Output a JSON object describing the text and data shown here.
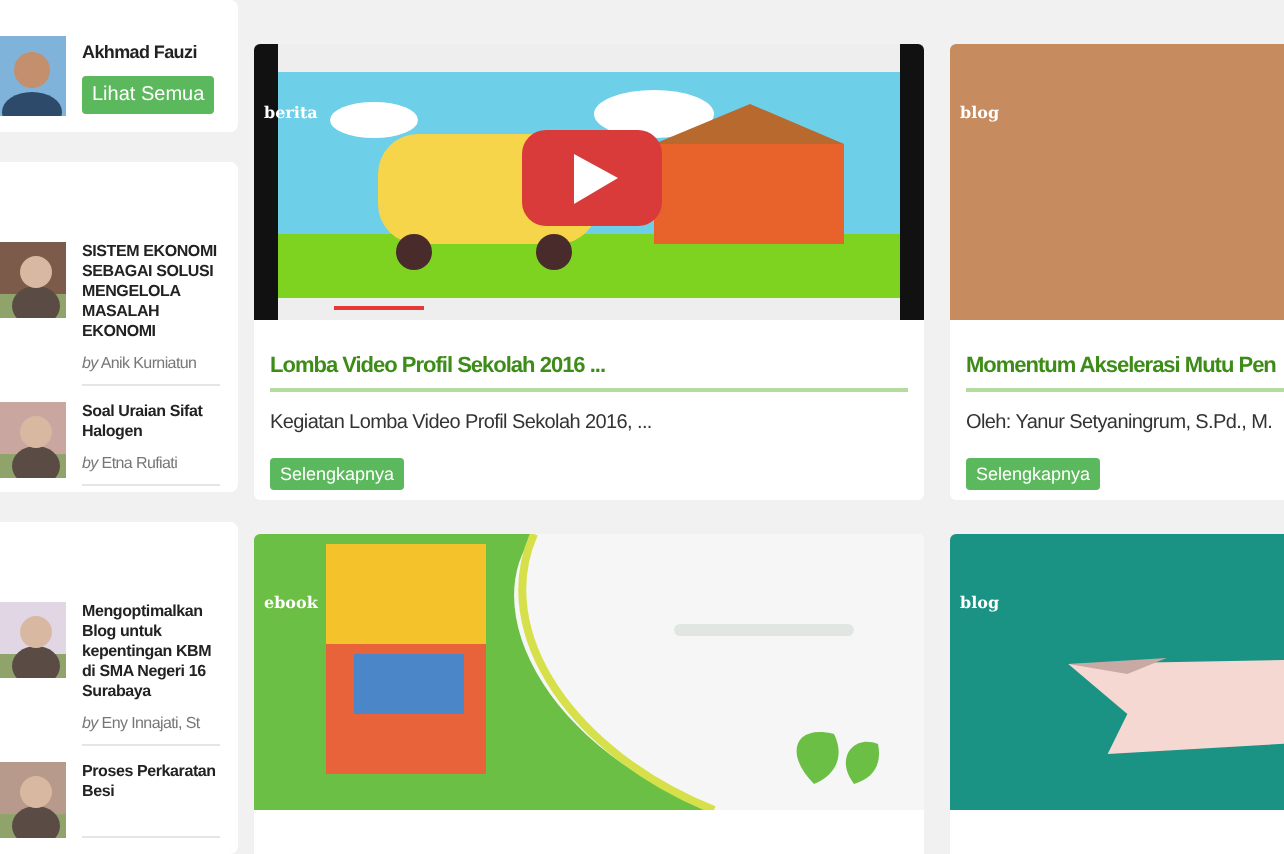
{
  "profile": {
    "name": "Akhmad Fauzi",
    "button": "Lihat Semua"
  },
  "sidebar_groups": [
    {
      "posts": [
        {
          "title": "SISTEM EKONOMI SEBAGAI SOLUSI MENGELOLA MASALAH EKONOMI",
          "by": "by",
          "author": "Anik Kurniatun"
        },
        {
          "title": "Soal Uraian Sifat Halogen",
          "by": "by",
          "author": "Etna Rufiati"
        }
      ]
    },
    {
      "posts": [
        {
          "title": "Mengoptimalkan Blog untuk kepentingan KBM di SMA Negeri 16 Surabaya",
          "by": "by",
          "author": "Eny Innajati, St"
        },
        {
          "title": "Proses Perkaratan Besi"
        }
      ]
    }
  ],
  "cards": [
    {
      "label": "berita",
      "title": "Lomba Video Profil Sekolah 2016 ...",
      "text": "Kegiatan Lomba Video Profil Sekolah 2016, ...",
      "button": "Selengkapnya"
    },
    {
      "label": "blog",
      "title": "Momentum Akselerasi Mutu Pen",
      "text": "Oleh: Yanur Setyaningrum, S.Pd., M.",
      "button": "Selengkapnya"
    },
    {
      "label": "ebook"
    },
    {
      "label": "blog"
    }
  ]
}
